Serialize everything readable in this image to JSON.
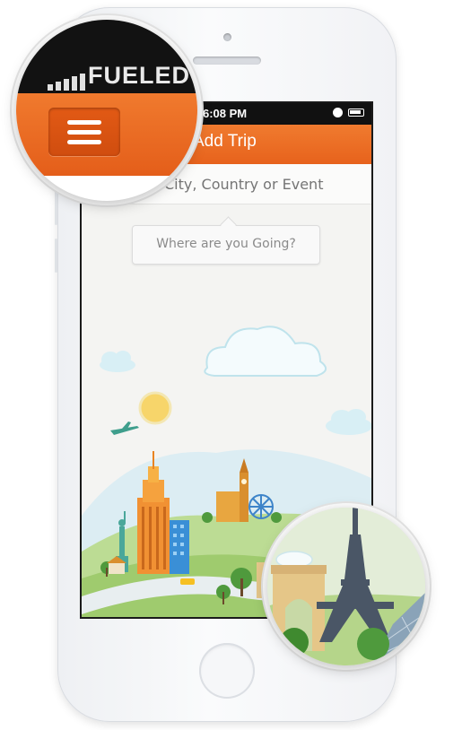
{
  "status_bar": {
    "time": "6:08 PM"
  },
  "nav": {
    "title": "Add Trip"
  },
  "search": {
    "placeholder": "City, Country or Event"
  },
  "tooltip": {
    "text": "Where are you Going?"
  },
  "magnifier": {
    "carrier": "FUELED"
  },
  "icons": {
    "menu": "menu-icon",
    "alarm": "alarm-icon",
    "battery": "battery-icon",
    "signal": "signal-icon"
  },
  "colors": {
    "nav_orange": "#ea6a22",
    "status_black": "#111111",
    "screen_bg": "#f4f4f2"
  }
}
